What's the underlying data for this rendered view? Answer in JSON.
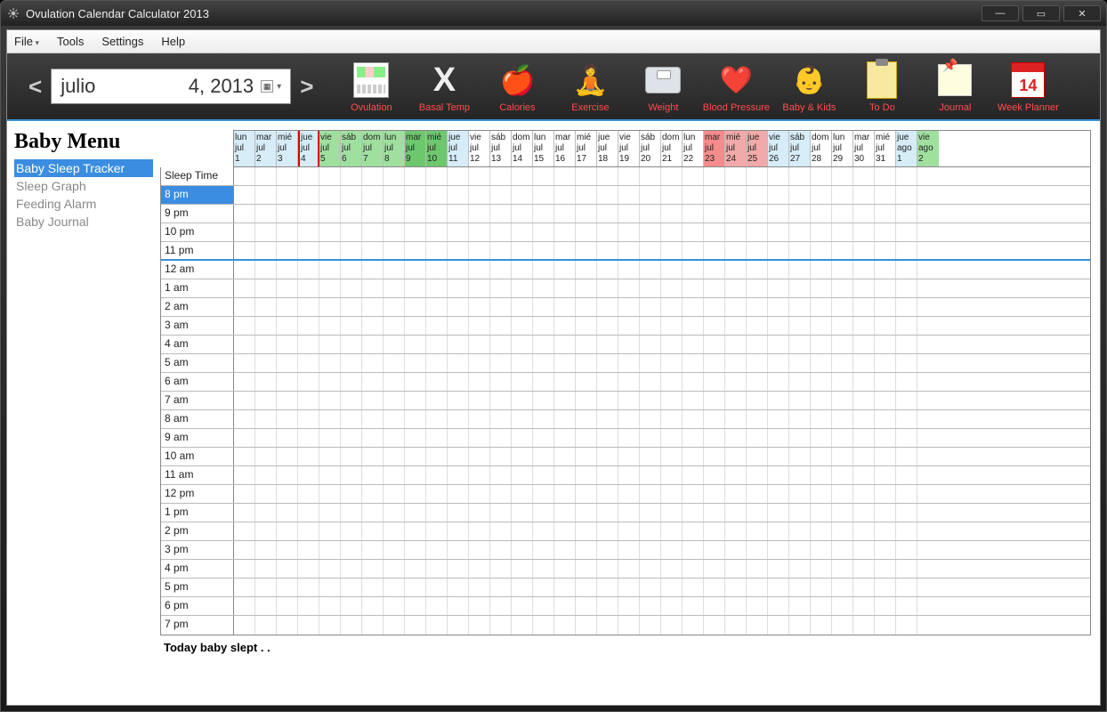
{
  "window": {
    "title": "Ovulation Calendar Calculator 2013"
  },
  "menu": {
    "file": "File",
    "tools": "Tools",
    "settings": "Settings",
    "help": "Help"
  },
  "date": {
    "month": "julio",
    "dayyear": "4, 2013"
  },
  "toolbar": [
    {
      "label": "Ovulation",
      "icon": "calendar-icon"
    },
    {
      "label": "Basal Temp",
      "icon": "thermometer-cross-icon"
    },
    {
      "label": "Calories",
      "icon": "apples-icon"
    },
    {
      "label": "Exercise",
      "icon": "exercise-icon"
    },
    {
      "label": "Weight",
      "icon": "scale-icon"
    },
    {
      "label": "Blood Pressure",
      "icon": "heart-icon"
    },
    {
      "label": "Baby & Kids",
      "icon": "baby-icon"
    },
    {
      "label": "To Do",
      "icon": "clipboard-icon"
    },
    {
      "label": "Journal",
      "icon": "sticky-note-icon"
    },
    {
      "label": "Week Planner",
      "icon": "week-calendar-icon",
      "badge": "14"
    }
  ],
  "sidebar": {
    "heading": "Baby Menu",
    "items": [
      "Baby Sleep Tracker",
      "Sleep Graph",
      "Feeding Alarm",
      "Baby Journal"
    ],
    "selected": 0
  },
  "calendar_header": [
    {
      "weekday": "lun",
      "month": "jul",
      "day": "1",
      "color": "blue"
    },
    {
      "weekday": "mar",
      "month": "jul",
      "day": "2",
      "color": "blue"
    },
    {
      "weekday": "mié",
      "month": "jul",
      "day": "3",
      "color": "blue"
    },
    {
      "weekday": "jue",
      "month": "jul",
      "day": "4",
      "color": "blue",
      "today": true
    },
    {
      "weekday": "vie",
      "month": "jul",
      "day": "5",
      "color": "green"
    },
    {
      "weekday": "sáb",
      "month": "jul",
      "day": "6",
      "color": "green"
    },
    {
      "weekday": "dom",
      "month": "jul",
      "day": "7",
      "color": "green"
    },
    {
      "weekday": "lun",
      "month": "jul",
      "day": "8",
      "color": "green"
    },
    {
      "weekday": "mar",
      "month": "jul",
      "day": "9",
      "color": "dgreen"
    },
    {
      "weekday": "mié",
      "month": "jul",
      "day": "10",
      "color": "dgreen"
    },
    {
      "weekday": "jue",
      "month": "jul",
      "day": "11",
      "color": "blue"
    },
    {
      "weekday": "vie",
      "month": "jul",
      "day": "12",
      "color": ""
    },
    {
      "weekday": "sáb",
      "month": "jul",
      "day": "13",
      "color": ""
    },
    {
      "weekday": "dom",
      "month": "jul",
      "day": "14",
      "color": ""
    },
    {
      "weekday": "lun",
      "month": "jul",
      "day": "15",
      "color": ""
    },
    {
      "weekday": "mar",
      "month": "jul",
      "day": "16",
      "color": ""
    },
    {
      "weekday": "mié",
      "month": "jul",
      "day": "17",
      "color": ""
    },
    {
      "weekday": "jue",
      "month": "jul",
      "day": "18",
      "color": ""
    },
    {
      "weekday": "vie",
      "month": "jul",
      "day": "19",
      "color": ""
    },
    {
      "weekday": "sáb",
      "month": "jul",
      "day": "20",
      "color": ""
    },
    {
      "weekday": "dom",
      "month": "jul",
      "day": "21",
      "color": ""
    },
    {
      "weekday": "lun",
      "month": "jul",
      "day": "22",
      "color": ""
    },
    {
      "weekday": "mar",
      "month": "jul",
      "day": "23",
      "color": "dred"
    },
    {
      "weekday": "mié",
      "month": "jul",
      "day": "24",
      "color": "red"
    },
    {
      "weekday": "jue",
      "month": "jul",
      "day": "25",
      "color": "red"
    },
    {
      "weekday": "vie",
      "month": "jul",
      "day": "26",
      "color": "blue"
    },
    {
      "weekday": "sáb",
      "month": "jul",
      "day": "27",
      "color": "blue"
    },
    {
      "weekday": "dom",
      "month": "jul",
      "day": "28",
      "color": ""
    },
    {
      "weekday": "lun",
      "month": "jul",
      "day": "29",
      "color": ""
    },
    {
      "weekday": "mar",
      "month": "jul",
      "day": "30",
      "color": ""
    },
    {
      "weekday": "mié",
      "month": "jul",
      "day": "31",
      "color": ""
    },
    {
      "weekday": "jue",
      "month": "ago",
      "day": "1",
      "color": "blue"
    },
    {
      "weekday": "vie",
      "month": "ago",
      "day": "2",
      "color": "green"
    }
  ],
  "grid": {
    "header_label": "Sleep Time",
    "rows": [
      "8 pm",
      "9 pm",
      "10 pm",
      "11 pm",
      "12 am",
      "1 am",
      "2 am",
      "3 am",
      "4 am",
      "5 am",
      "6 am",
      "7 am",
      "8 am",
      "9 am",
      "10 am",
      "11 am",
      "12 pm",
      "1 pm",
      "2 pm",
      "3 pm",
      "4 pm",
      "5 pm",
      "6 pm",
      "7 pm"
    ],
    "selected": 0,
    "separator_after": 3
  },
  "footer": {
    "text": "Today baby slept .                                         ."
  },
  "week_badge": "14"
}
